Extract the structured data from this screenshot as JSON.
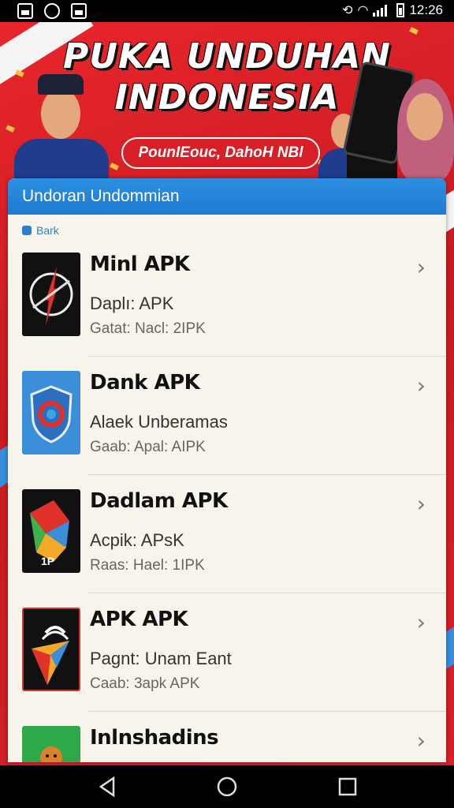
{
  "status_bar": {
    "battery_percent": "",
    "time": "12:26",
    "left_icons": [
      "notification-icon",
      "whatsapp-icon",
      "gallery-icon"
    ],
    "right_icons": [
      "sync-icon",
      "wifi-icon",
      "signal-icon",
      "battery-icon"
    ]
  },
  "banner": {
    "title_line1": "PUKA UNDUHAN",
    "title_line2": "INDONESIA",
    "subtitle": "PounIEouc, DahoH NBl"
  },
  "panel": {
    "header_title": "Undoran Undommian",
    "back_label": "Bark"
  },
  "apps": [
    {
      "name": "Minl APK",
      "desc": "Daplı: APK",
      "size": "Gatat: Nacl: 2IPK",
      "icon": "compass-app-icon"
    },
    {
      "name": "Dank APK",
      "desc": "Alaek Unberamas",
      "size": "Gaab: Apal: AIPK",
      "icon": "shield-app-icon"
    },
    {
      "name": "Dadlam APK",
      "desc": "Acpik: APsK",
      "size": "Raas: Hael: 1IPK",
      "icon": "map-app-icon"
    },
    {
      "name": "APK APK",
      "desc": "Pagnt: Unam Eant",
      "size": "Caab: 3apk APK",
      "icon": "arrow-app-icon"
    },
    {
      "name": "Inlnshadins",
      "desc": "",
      "size": "",
      "icon": "character-app-icon"
    }
  ],
  "colors": {
    "banner_red": "#d92028",
    "header_blue": "#1f7bd0",
    "panel_bg": "#f7f4ec"
  }
}
